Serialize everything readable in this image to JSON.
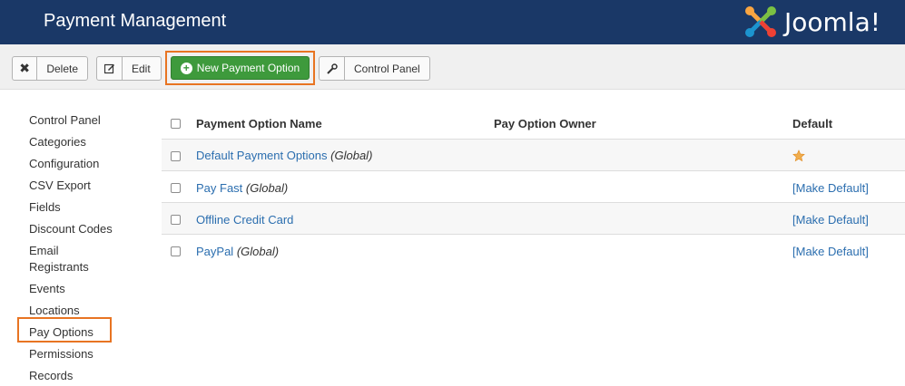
{
  "header": {
    "title": "Payment Management",
    "logo_text": "Joomla!"
  },
  "toolbar": {
    "delete_label": "Delete",
    "edit_label": "Edit",
    "new_label": "New Payment Option",
    "control_panel_label": "Control Panel"
  },
  "sidebar": {
    "items": [
      {
        "label": "Control Panel"
      },
      {
        "label": "Categories"
      },
      {
        "label": "Configuration"
      },
      {
        "label": "CSV Export"
      },
      {
        "label": "Fields"
      },
      {
        "label": "Discount Codes"
      },
      {
        "label": "Email Registrants"
      },
      {
        "label": "Events"
      },
      {
        "label": "Locations"
      },
      {
        "label": "Pay Options"
      },
      {
        "label": "Permissions"
      },
      {
        "label": "Records"
      }
    ],
    "active": "Pay Options"
  },
  "table": {
    "headers": {
      "name": "Payment Option Name",
      "owner": "Pay Option Owner",
      "default": "Default"
    },
    "rows": [
      {
        "name": "Default Payment Options",
        "scope": "(Global)",
        "owner": "",
        "default": "",
        "is_default": true
      },
      {
        "name": "Pay Fast",
        "scope": "(Global)",
        "owner": "",
        "default": "[Make Default]",
        "is_default": false
      },
      {
        "name": "Offline Credit Card",
        "scope": "",
        "owner": "",
        "default": "[Make Default]",
        "is_default": false
      },
      {
        "name": "PayPal",
        "scope": "(Global)",
        "owner": "",
        "default": "[Make Default]",
        "is_default": false
      }
    ]
  },
  "colors": {
    "header_bg": "#1a3867",
    "new_button": "#3e9a3c",
    "highlight": "#e87422",
    "link": "#2b6eaf",
    "star": "#f0ad4e"
  },
  "icons": {
    "delete": "x-icon",
    "edit": "edit-icon",
    "new": "plus-circle-icon",
    "control_panel": "wrench-icon",
    "default": "star-icon"
  }
}
